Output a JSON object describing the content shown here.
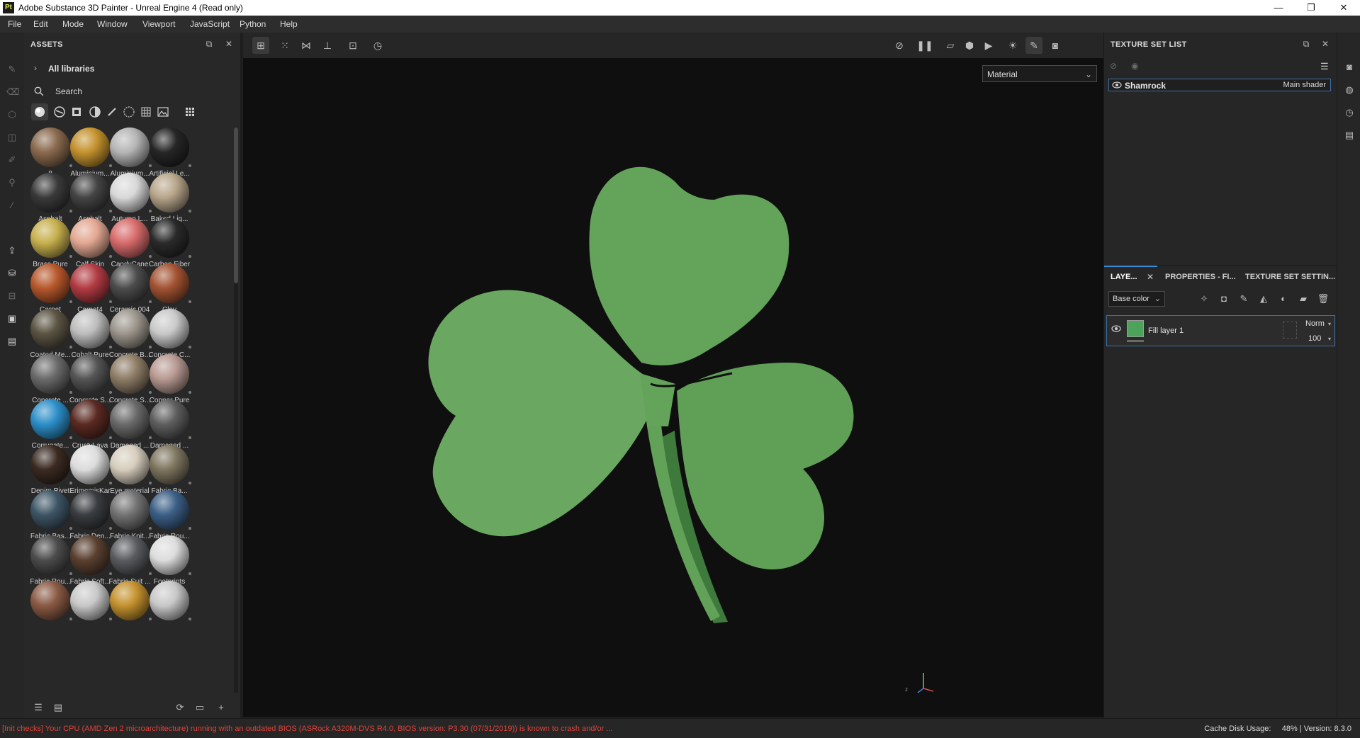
{
  "window": {
    "app_icon_text": "Pt",
    "title": "Adobe Substance 3D Painter - Unreal Engine 4 (Read only)",
    "controls": {
      "minimize": "—",
      "maximize": "❐",
      "close": "✕"
    }
  },
  "menu": [
    "File",
    "Edit",
    "Mode",
    "Window",
    "Viewport",
    "JavaScript",
    "Python",
    "Help"
  ],
  "assets": {
    "title": "ASSETS",
    "library": "All libraries",
    "search_placeholder": "Search",
    "items": [
      {
        "name": "8",
        "color": "#8a6a4e"
      },
      {
        "name": "Aluminium...",
        "color": "#c4922e"
      },
      {
        "name": "Aluminium...",
        "color": "#b5b5b5"
      },
      {
        "name": "Artificial Le...",
        "color": "#262626"
      },
      {
        "name": "Asphalt",
        "color": "#3a3a3a"
      },
      {
        "name": "Asphalt",
        "color": "#444444"
      },
      {
        "name": "Autumn L...",
        "color": "#d8d8d8"
      },
      {
        "name": "Baked Lig...",
        "color": "#b7a58a"
      },
      {
        "name": "Brass Pure",
        "color": "#c7b04e"
      },
      {
        "name": "Calf Skin",
        "color": "#e3a892"
      },
      {
        "name": "CandyCane",
        "color": "#d86b6b"
      },
      {
        "name": "Carbon Fiber",
        "color": "#2a2a2a"
      },
      {
        "name": "Carpet",
        "color": "#b8582c"
      },
      {
        "name": "Carpet4",
        "color": "#b23b43"
      },
      {
        "name": "Ceramic 004",
        "color": "#4c4c4c"
      },
      {
        "name": "Clay",
        "color": "#a35332"
      },
      {
        "name": "Coated Me...",
        "color": "#5b5443"
      },
      {
        "name": "Cobalt Pure",
        "color": "#bdbdbd"
      },
      {
        "name": "Concrete B...",
        "color": "#9c968c"
      },
      {
        "name": "Concrete C...",
        "color": "#c9c9c9"
      },
      {
        "name": "Concrete ...",
        "color": "#6b6b6b"
      },
      {
        "name": "Concrete S...",
        "color": "#555555"
      },
      {
        "name": "Concrete S...",
        "color": "#8e7d66"
      },
      {
        "name": "Copper Pure",
        "color": "#b89a92"
      },
      {
        "name": "Corrugate...",
        "color": "#2d8fc9"
      },
      {
        "name": "CrustyLava",
        "color": "#5a2a22"
      },
      {
        "name": "Damaged ...",
        "color": "#6a6a6a"
      },
      {
        "name": "Damaged ...",
        "color": "#5e5e5e"
      },
      {
        "name": "Denim Rivet",
        "color": "#3b2a22"
      },
      {
        "name": "ErimemisKar",
        "color": "#dcdcdc"
      },
      {
        "name": "Eye material",
        "color": "#d6cdbd"
      },
      {
        "name": "Fabric Ba...",
        "color": "#7f7660"
      },
      {
        "name": "Fabric Bas...",
        "color": "#3e5566"
      },
      {
        "name": "Fabric Den...",
        "color": "#3a3d41"
      },
      {
        "name": "Fabric Knit...",
        "color": "#737373"
      },
      {
        "name": "Fabric Rou...",
        "color": "#3c5f86"
      },
      {
        "name": "Fabric Rou...",
        "color": "#4c4c4c"
      },
      {
        "name": "Fabric Soft...",
        "color": "#5a4030"
      },
      {
        "name": "Fabric Suit ...",
        "color": "#5a5c60"
      },
      {
        "name": "Footprints",
        "color": "#dcdcdc"
      },
      {
        "name": "",
        "color": "#8a5a44"
      },
      {
        "name": "",
        "color": "#c8c8c8"
      },
      {
        "name": "",
        "color": "#c4922e"
      },
      {
        "name": "",
        "color": "#c8c8c8"
      }
    ]
  },
  "viewport": {
    "material_mode": "Material",
    "model_color": "#5f9e56",
    "model_shadow": "#3f7a3d",
    "background": "#0f0f0f",
    "axis_label": "z"
  },
  "texture_set_list": {
    "title": "TEXTURE SET LIST",
    "rows": [
      {
        "name": "Shamrock",
        "shader": "Main shader"
      }
    ]
  },
  "layers": {
    "tabs": [
      "LAYE...",
      "PROPERTIES - FI...",
      "TEXTURE SET SETTIN..."
    ],
    "channel": "Base color",
    "items": [
      {
        "name": "Fill layer 1",
        "blend": "Norm",
        "opacity": "100",
        "thumb_color": "#4ea35a"
      }
    ]
  },
  "status": {
    "message": "[Init checks] Your CPU (AMD Zen 2 microarchitecture) running with an outdated BIOS (ASRock A320M-DVS R4.0, BIOS version: P3.30 (07/31/2019)) is known to crash and/or ...",
    "cache_label": "Cache Disk Usage:",
    "cache_value": "48%",
    "version": "Version: 8.3.0",
    "separator": "|"
  },
  "accent_color": "#3a8ed8"
}
